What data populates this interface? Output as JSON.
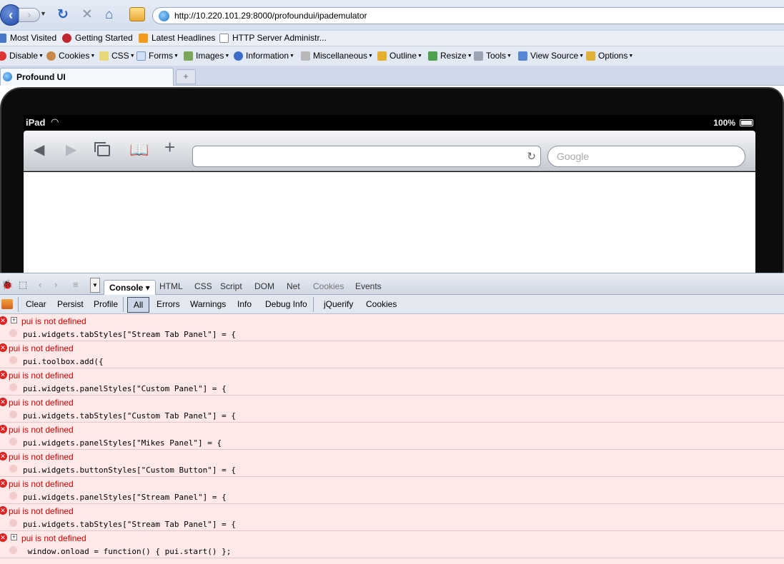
{
  "browser": {
    "url": "http://10.220.101.29:8000/profoundui/ipademulator",
    "bookmarks": [
      "Most Visited",
      "Getting Started",
      "Latest Headlines",
      "HTTP Server Administr..."
    ],
    "webdev_toolbar": [
      "Disable",
      "Cookies",
      "CSS",
      "Forms",
      "Images",
      "Information",
      "Miscellaneous",
      "Outline",
      "Resize",
      "Tools",
      "View Source",
      "Options"
    ],
    "tab_title": "Profound UI",
    "newtab_label": "+"
  },
  "ipad": {
    "carrier": "iPad",
    "battery": "100%",
    "search_placeholder": "Google"
  },
  "firebug": {
    "console_tab": "Console",
    "panel_tabs": [
      "HTML",
      "CSS",
      "Script",
      "DOM",
      "Net",
      "Cookies",
      "Events"
    ],
    "filter_buttons": [
      "Clear",
      "Persist",
      "Profile",
      "All",
      "Errors",
      "Warnings",
      "Info",
      "Debug Info",
      "jQuerify",
      "Cookies"
    ],
    "entries": [
      {
        "message": "pui is not defined",
        "source": "pui.widgets.tabStyles[\"Stream Tab Panel\"] = {"
      },
      {
        "message": "pui is not defined",
        "source": "pui.toolbox.add({"
      },
      {
        "message": "pui is not defined",
        "source": "pui.widgets.panelStyles[\"Custom Panel\"] = {"
      },
      {
        "message": "pui is not defined",
        "source": "pui.widgets.tabStyles[\"Custom Tab Panel\"] = {"
      },
      {
        "message": "pui is not defined",
        "source": "pui.widgets.panelStyles[\"Mikes Panel\"] = {"
      },
      {
        "message": "pui is not defined",
        "source": "pui.widgets.buttonStyles[\"Custom Button\"] = {"
      },
      {
        "message": "pui is not defined",
        "source": "pui.widgets.panelStyles[\"Stream Panel\"] = {"
      },
      {
        "message": "pui is not defined",
        "source": "pui.widgets.tabStyles[\"Stream Tab Panel\"] = {"
      },
      {
        "message": "pui is not defined",
        "source": " window.onload = function() { pui.start() };"
      }
    ]
  },
  "colors": {
    "error_text": "#d10000",
    "console_bg": "#ffe8e8"
  }
}
